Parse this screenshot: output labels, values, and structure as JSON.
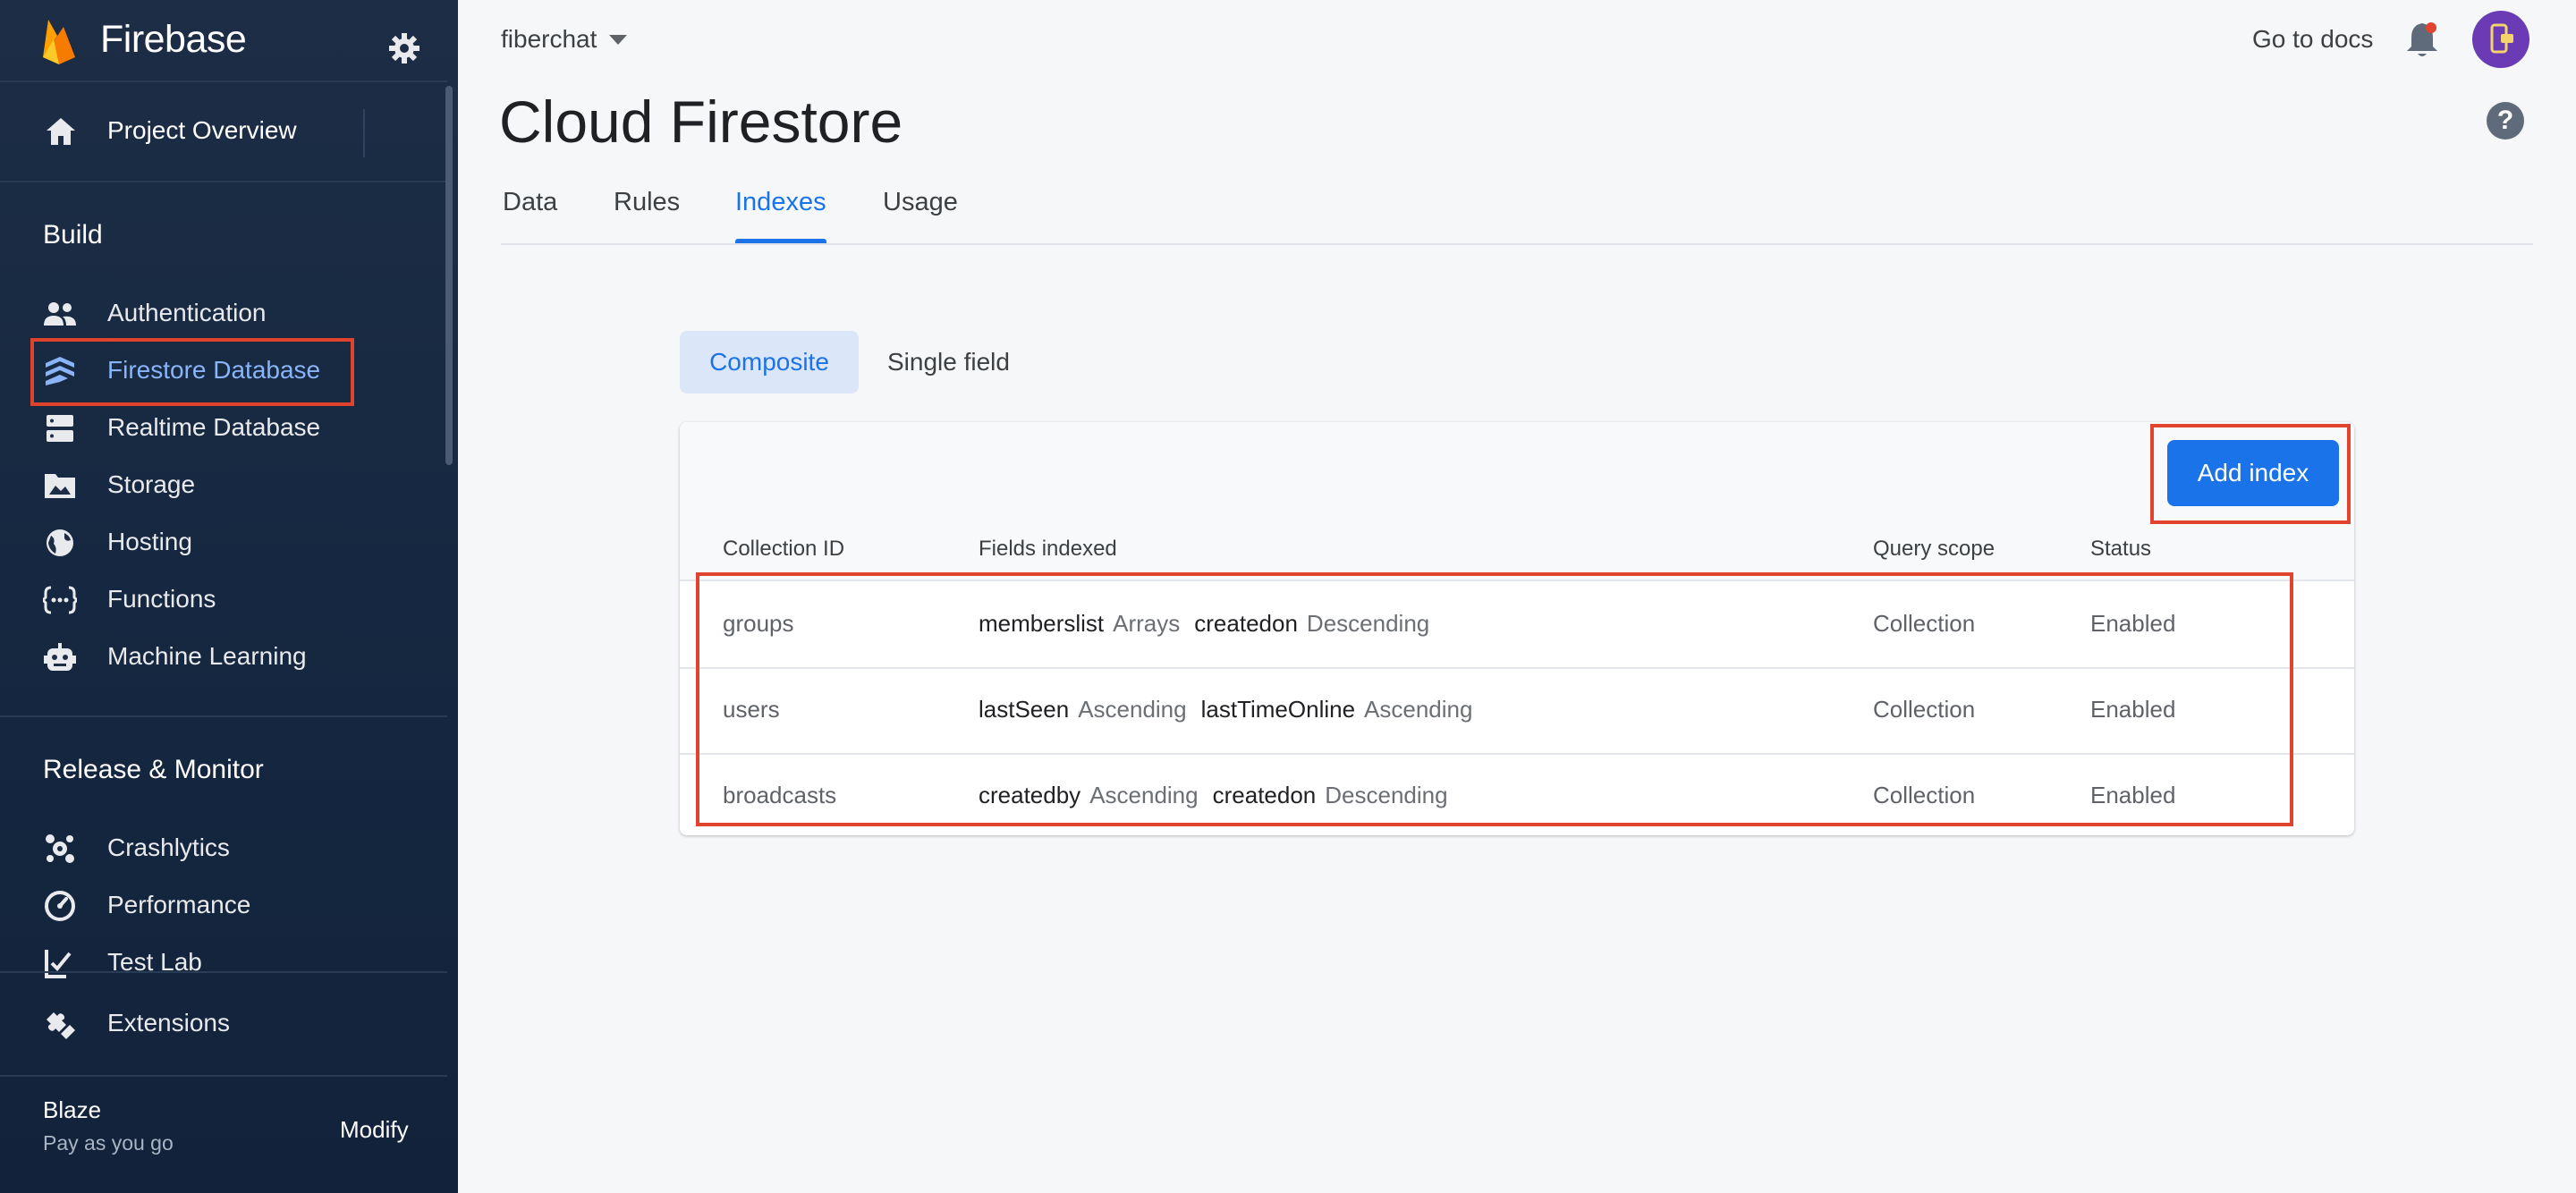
{
  "brand": {
    "name": "Firebase"
  },
  "sidebar": {
    "overview_label": "Project Overview",
    "build_title": "Build",
    "build_items": [
      {
        "label": "Authentication",
        "icon": "people-icon"
      },
      {
        "label": "Firestore Database",
        "icon": "firestore-icon",
        "active": true
      },
      {
        "label": "Realtime Database",
        "icon": "database-icon"
      },
      {
        "label": "Storage",
        "icon": "image-folder-icon"
      },
      {
        "label": "Hosting",
        "icon": "globe-icon"
      },
      {
        "label": "Functions",
        "icon": "functions-icon"
      },
      {
        "label": "Machine Learning",
        "icon": "robot-icon"
      }
    ],
    "release_title": "Release & Monitor",
    "release_items": [
      {
        "label": "Crashlytics",
        "icon": "crashlytics-icon"
      },
      {
        "label": "Performance",
        "icon": "speedometer-icon"
      },
      {
        "label": "Test Lab",
        "icon": "checklist-icon"
      }
    ],
    "extensions_label": "Extensions",
    "plan": {
      "name": "Blaze",
      "description": "Pay as you go",
      "modify_label": "Modify"
    }
  },
  "header": {
    "project_name": "fiberchat",
    "docs_label": "Go to docs",
    "page_title": "Cloud Firestore",
    "help_symbol": "?"
  },
  "tabs": [
    {
      "label": "Data"
    },
    {
      "label": "Rules"
    },
    {
      "label": "Indexes",
      "active": true
    },
    {
      "label": "Usage"
    }
  ],
  "toggle": {
    "composite": "Composite",
    "single_field": "Single field",
    "selected": "Composite"
  },
  "indexes": {
    "add_label": "Add index",
    "columns": {
      "collection": "Collection ID",
      "fields": "Fields indexed",
      "scope": "Query scope",
      "status": "Status"
    },
    "rows": [
      {
        "collection": "groups",
        "f1": "memberslist",
        "o1": "Arrays",
        "f2": "createdon",
        "o2": "Descending",
        "scope": "Collection",
        "status": "Enabled"
      },
      {
        "collection": "users",
        "f1": "lastSeen",
        "o1": "Ascending",
        "f2": "lastTimeOnline",
        "o2": "Ascending",
        "scope": "Collection",
        "status": "Enabled"
      },
      {
        "collection": "broadcasts",
        "f1": "createdby",
        "o1": "Ascending",
        "f2": "createdon",
        "o2": "Descending",
        "scope": "Collection",
        "status": "Enabled"
      }
    ]
  },
  "colors": {
    "accent": "#1a73e8",
    "highlight": "#e0432e",
    "sidebar_bg": "#1c2d45",
    "active_nav": "#8ab4f8"
  }
}
